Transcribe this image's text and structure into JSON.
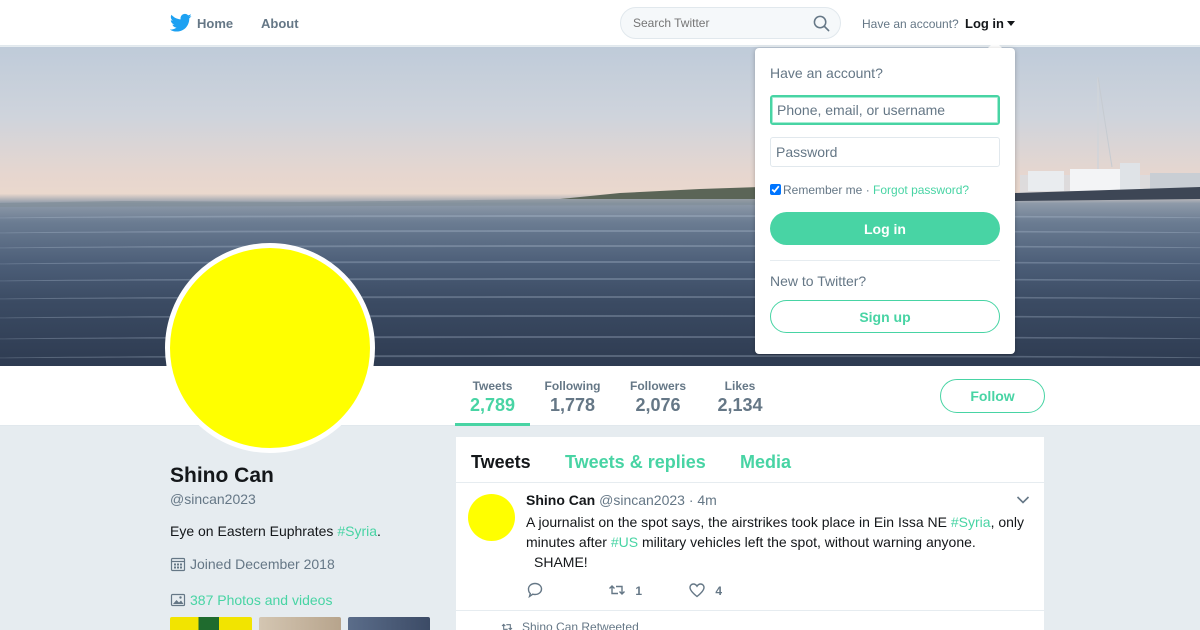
{
  "nav": {
    "home_label": "Home",
    "about_label": "About",
    "search_placeholder": "Search Twitter",
    "have_account": "Have an account?",
    "login_label": "Log in"
  },
  "colors": {
    "accent": "#48d4a4",
    "avatar": "#ffff00",
    "muted_text": "#657786"
  },
  "stats": {
    "tweets_label": "Tweets",
    "tweets_value": "2,789",
    "following_label": "Following",
    "following_value": "1,778",
    "followers_label": "Followers",
    "followers_value": "2,076",
    "likes_label": "Likes",
    "likes_value": "2,134",
    "follow_label": "Follow"
  },
  "profile": {
    "name": "Shino Can",
    "handle": "@sincan2023",
    "bio_text": "Eye on Eastern Euphrates ",
    "bio_hashtag": "#Syria",
    "bio_end": ".",
    "joined": "Joined December 2018",
    "photos_link": "387 Photos and videos"
  },
  "timeline": {
    "tabs": [
      "Tweets",
      "Tweets & replies",
      "Media"
    ],
    "tweet": {
      "name": "Shino Can",
      "handle": "@sincan2023",
      "time": "· 4m",
      "text_1": "A journalist on the spot says, the airstrikes took place in Ein Issa NE ",
      "hashtag_1": "#Syria",
      "text_2": ", only minutes after ",
      "hashtag_2": "#US",
      "text_3": " military vehicles left the spot, without warning anyone.",
      "text_4": "SHAME!",
      "retweets": "1",
      "likes": "4"
    },
    "retweeted_label": "Shino Can Retweeted"
  },
  "login_dropdown": {
    "title": "Have an account?",
    "username_placeholder": "Phone, email, or username",
    "password_placeholder": "Password",
    "remember_label": "Remember me",
    "separator": "·",
    "forgot_label": "Forgot password?",
    "login_button": "Log in",
    "new_label": "New to Twitter?",
    "signup_button": "Sign up"
  }
}
